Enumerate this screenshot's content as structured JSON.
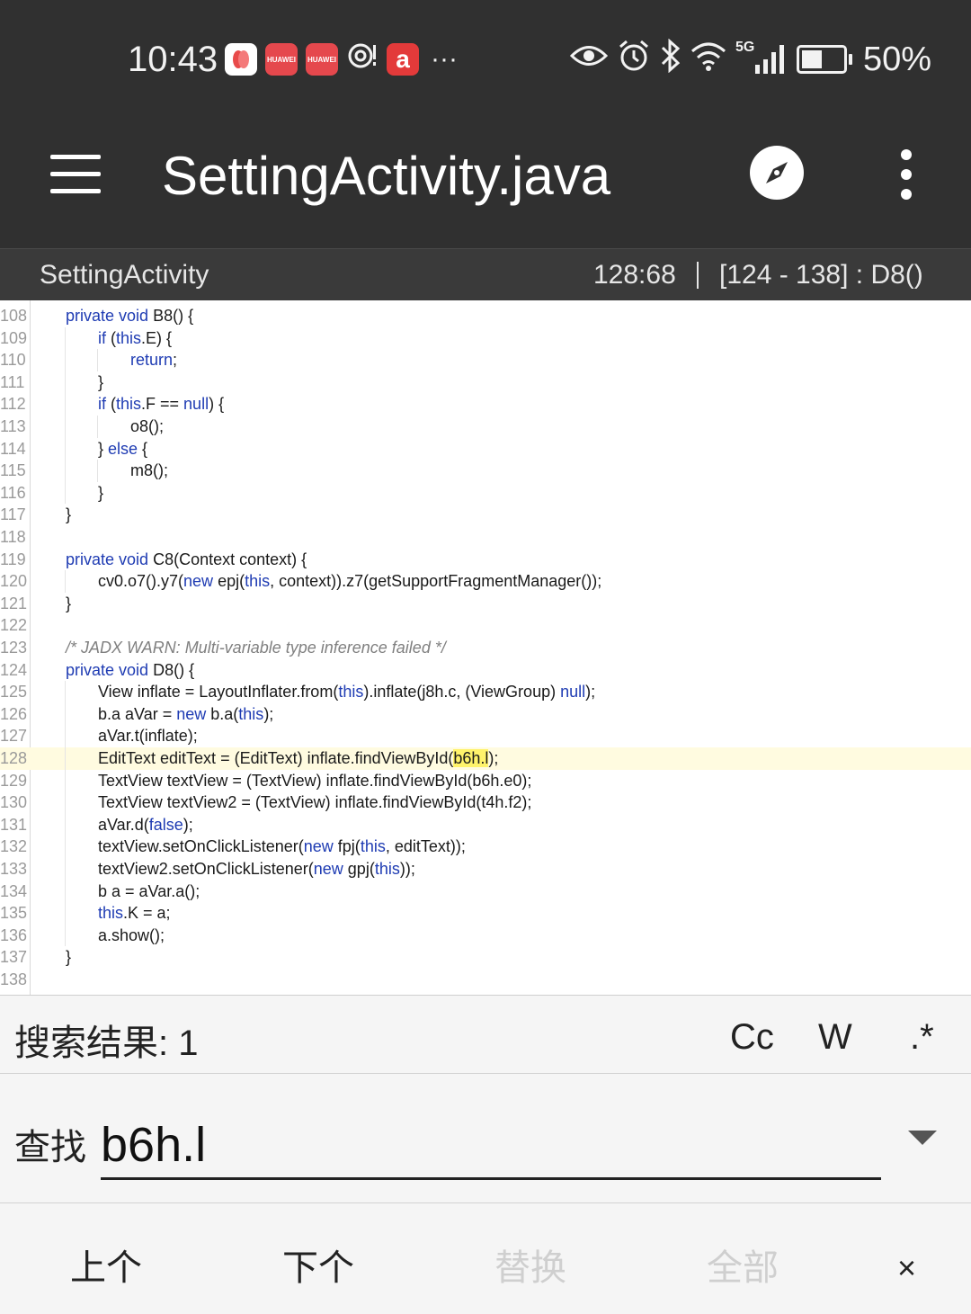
{
  "status_bar": {
    "time": "10:43",
    "app_icons": [
      "petal-icon",
      "huawei-appgallery-icon",
      "huawei-appgallery-icon",
      "nfc-icon",
      "a-app-icon"
    ],
    "hw_label": "HUAWEI",
    "a_label": "a",
    "more": "···",
    "right_icons": [
      "eye-icon",
      "alarm-icon",
      "bluetooth-icon",
      "wifi-icon",
      "5g-signal-icon",
      "battery-icon"
    ],
    "network": "5G",
    "battery_level": 0.5,
    "battery_text": "50%"
  },
  "toolbar": {
    "title": "SettingActivity.java"
  },
  "subbar": {
    "class_name": "SettingActivity",
    "cursor": "128:68",
    "range": "[124 - 138] : D8()"
  },
  "code": {
    "highlight_line": "128",
    "lines": [
      {
        "n": "108",
        "indent": 1,
        "segs": [
          [
            "kw",
            "private"
          ],
          [
            "t",
            " "
          ],
          [
            "kw",
            "void"
          ],
          [
            "t",
            " B8() {"
          ]
        ]
      },
      {
        "n": "109",
        "indent": 2,
        "segs": [
          [
            "kw",
            "if"
          ],
          [
            "t",
            " ("
          ],
          [
            "kw",
            "this"
          ],
          [
            "t",
            ".E) {"
          ]
        ]
      },
      {
        "n": "110",
        "indent": 3,
        "segs": [
          [
            "kw",
            "return"
          ],
          [
            "t",
            ";"
          ]
        ]
      },
      {
        "n": "111",
        "indent": 2,
        "segs": [
          [
            "t",
            "}"
          ]
        ]
      },
      {
        "n": "112",
        "indent": 2,
        "segs": [
          [
            "kw",
            "if"
          ],
          [
            "t",
            " ("
          ],
          [
            "kw",
            "this"
          ],
          [
            "t",
            ".F == "
          ],
          [
            "kw",
            "null"
          ],
          [
            "t",
            ") {"
          ]
        ]
      },
      {
        "n": "113",
        "indent": 3,
        "segs": [
          [
            "t",
            "o8();"
          ]
        ]
      },
      {
        "n": "114",
        "indent": 2,
        "segs": [
          [
            "t",
            "} "
          ],
          [
            "kw",
            "else"
          ],
          [
            "t",
            " {"
          ]
        ]
      },
      {
        "n": "115",
        "indent": 3,
        "segs": [
          [
            "t",
            "m8();"
          ]
        ]
      },
      {
        "n": "116",
        "indent": 2,
        "segs": [
          [
            "t",
            "}"
          ]
        ]
      },
      {
        "n": "117",
        "indent": 1,
        "segs": [
          [
            "t",
            "}"
          ]
        ]
      },
      {
        "n": "118",
        "indent": 0,
        "segs": []
      },
      {
        "n": "119",
        "indent": 1,
        "segs": [
          [
            "kw",
            "private"
          ],
          [
            "t",
            " "
          ],
          [
            "kw",
            "void"
          ],
          [
            "t",
            " C8(Context context) {"
          ]
        ]
      },
      {
        "n": "120",
        "indent": 2,
        "segs": [
          [
            "t",
            "cv0.o7().y7("
          ],
          [
            "kw",
            "new"
          ],
          [
            "t",
            " epj("
          ],
          [
            "kw",
            "this"
          ],
          [
            "t",
            ", context)).z7(getSupportFragmentManager());"
          ]
        ]
      },
      {
        "n": "121",
        "indent": 1,
        "segs": [
          [
            "t",
            "}"
          ]
        ]
      },
      {
        "n": "122",
        "indent": 0,
        "segs": []
      },
      {
        "n": "123",
        "indent": 1,
        "segs": [
          [
            "cm",
            "/* JADX WARN: Multi-variable type inference failed */"
          ]
        ]
      },
      {
        "n": "124",
        "indent": 1,
        "segs": [
          [
            "kw",
            "private"
          ],
          [
            "t",
            " "
          ],
          [
            "kw",
            "void"
          ],
          [
            "t",
            " D8() {"
          ]
        ]
      },
      {
        "n": "125",
        "indent": 2,
        "segs": [
          [
            "t",
            "View inflate = LayoutInflater.from("
          ],
          [
            "kw",
            "this"
          ],
          [
            "t",
            ").inflate(j8h.c, (ViewGroup) "
          ],
          [
            "kw",
            "null"
          ],
          [
            "t",
            ");"
          ]
        ]
      },
      {
        "n": "126",
        "indent": 2,
        "segs": [
          [
            "t",
            "b.a aVar = "
          ],
          [
            "kw",
            "new"
          ],
          [
            "t",
            " b.a("
          ],
          [
            "kw",
            "this"
          ],
          [
            "t",
            ");"
          ]
        ]
      },
      {
        "n": "127",
        "indent": 2,
        "segs": [
          [
            "t",
            "aVar.t(inflate);"
          ]
        ]
      },
      {
        "n": "128",
        "indent": 2,
        "segs": [
          [
            "t",
            "EditText editText = (EditText) inflate.findViewById("
          ],
          [
            "match",
            "b6h.l"
          ],
          [
            "t",
            ");"
          ]
        ]
      },
      {
        "n": "129",
        "indent": 2,
        "segs": [
          [
            "t",
            "TextView textView = (TextView) inflate.findViewById(b6h.e0);"
          ]
        ]
      },
      {
        "n": "130",
        "indent": 2,
        "segs": [
          [
            "t",
            "TextView textView2 = (TextView) inflate.findViewById(t4h.f2);"
          ]
        ]
      },
      {
        "n": "131",
        "indent": 2,
        "segs": [
          [
            "t",
            "aVar.d("
          ],
          [
            "kw",
            "false"
          ],
          [
            "t",
            ");"
          ]
        ]
      },
      {
        "n": "132",
        "indent": 2,
        "segs": [
          [
            "t",
            "textView.setOnClickListener("
          ],
          [
            "kw",
            "new"
          ],
          [
            "t",
            " fpj("
          ],
          [
            "kw",
            "this"
          ],
          [
            "t",
            ", editText));"
          ]
        ]
      },
      {
        "n": "133",
        "indent": 2,
        "segs": [
          [
            "t",
            "textView2.setOnClickListener("
          ],
          [
            "kw",
            "new"
          ],
          [
            "t",
            " gpj("
          ],
          [
            "kw",
            "this"
          ],
          [
            "t",
            "));"
          ]
        ]
      },
      {
        "n": "134",
        "indent": 2,
        "segs": [
          [
            "t",
            "b a = aVar.a();"
          ]
        ]
      },
      {
        "n": "135",
        "indent": 2,
        "segs": [
          [
            "kw",
            "this"
          ],
          [
            "t",
            ".K = a;"
          ]
        ]
      },
      {
        "n": "136",
        "indent": 2,
        "segs": [
          [
            "t",
            "a.show();"
          ]
        ]
      },
      {
        "n": "137",
        "indent": 1,
        "segs": [
          [
            "t",
            "}"
          ]
        ]
      },
      {
        "n": "138",
        "indent": 0,
        "segs": []
      }
    ]
  },
  "search": {
    "results_label": "搜索结果: 1",
    "options": {
      "case": "Cc",
      "word": "W",
      "regex": ".*"
    },
    "find_label": "查找",
    "find_value": "b6h.l",
    "prev": "上个",
    "next": "下个",
    "replace": "替换",
    "replace_all": "全部",
    "close": "×"
  },
  "colors": {
    "bar": "#303030",
    "keyword": "#1f3cb3",
    "match": "#fff36b",
    "line_highlight": "#fffbe0"
  }
}
